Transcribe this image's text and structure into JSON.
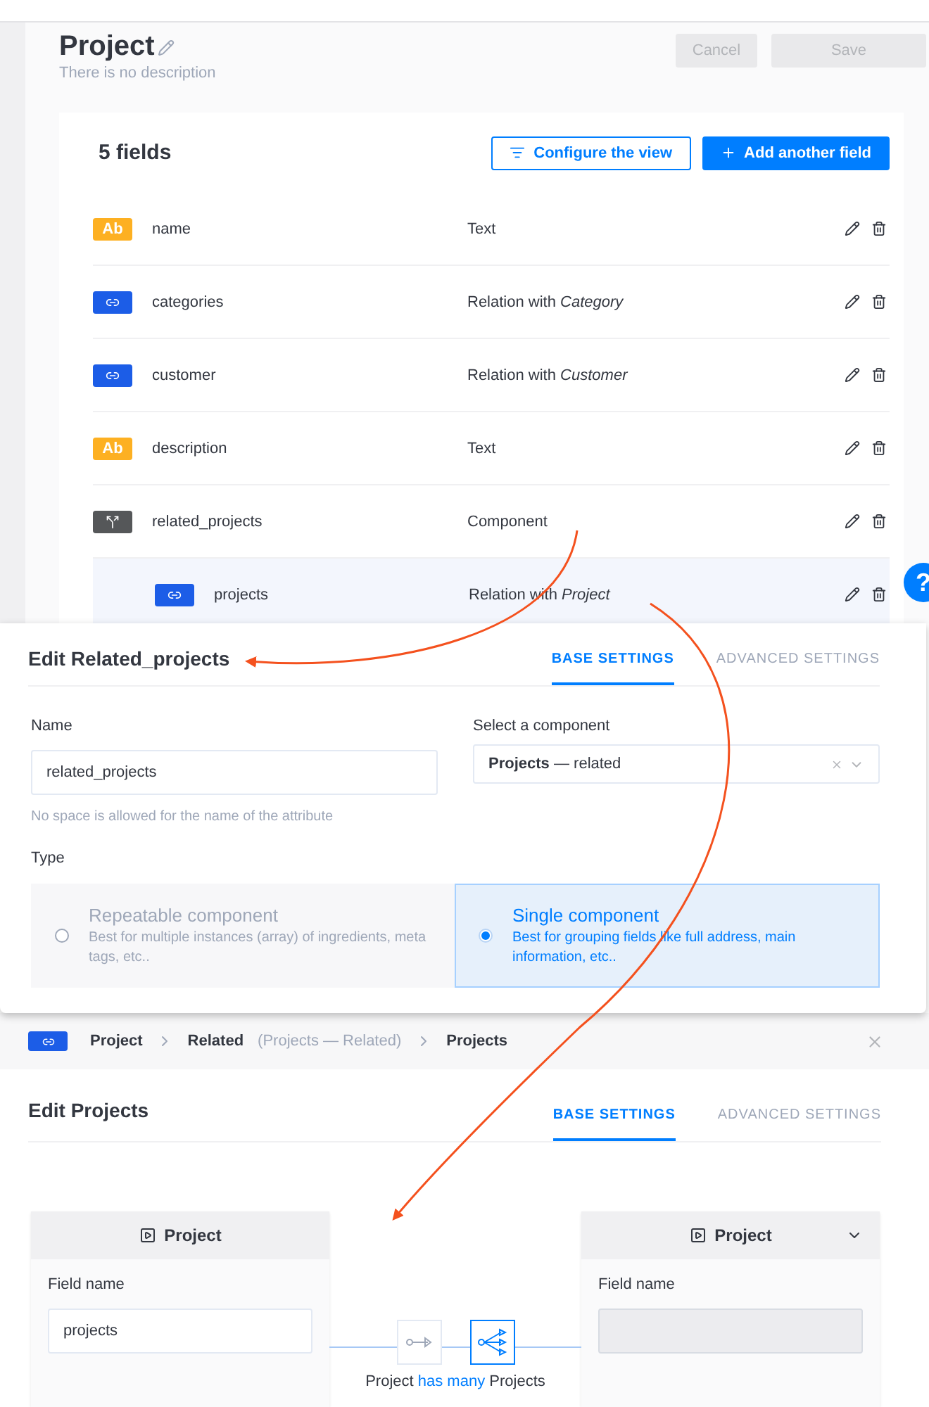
{
  "header": {
    "title": "Project",
    "description": "There is no description",
    "buttons": [
      {
        "label": "Cancel",
        "disabled": true
      },
      {
        "label": "Save",
        "disabled": true
      }
    ]
  },
  "fields_card": {
    "count": "5 fields",
    "actions": [
      {
        "label": "Configure the view",
        "kind": "secondary"
      },
      {
        "label": "Add another field",
        "kind": "primary"
      }
    ],
    "rows": [
      {
        "kind": "text",
        "badge": "Ab",
        "name": "name",
        "type": "Text",
        "highlighted": false
      },
      {
        "kind": "relation",
        "name": "categories",
        "type": "Relation with *Category*",
        "highlighted": false
      },
      {
        "kind": "relation",
        "name": "customer",
        "type": "Relation with *Customer*",
        "highlighted": false
      },
      {
        "kind": "text",
        "badge": "Ab",
        "name": "description",
        "type": "Text",
        "highlighted": false
      },
      {
        "kind": "component",
        "name": "related_projects",
        "type": "Component",
        "highlighted": false,
        "children": [
          {
            "kind": "relation",
            "name": "projects",
            "type": "Relation with *Project*",
            "highlighted": true
          }
        ]
      }
    ]
  },
  "help_button": "?",
  "component_modal": {
    "title": "Edit Related_projects",
    "tabs": [
      {
        "label": "BASE SETTINGS",
        "selected": true
      },
      {
        "label": "ADVANCED SETTINGS",
        "selected": false
      }
    ],
    "name_field": {
      "label": "Name",
      "value": "related_projects",
      "hint": "No space is allowed for the name of the attribute"
    },
    "component_select": {
      "label": "Select a component",
      "value": "**Projects** — related"
    },
    "type": {
      "label": "Type",
      "options": [
        {
          "title": "Repeatable component",
          "description": "Best for multiple instances (array) of ingredients, meta tags, etc..",
          "selected": false
        },
        {
          "title": "Single component",
          "description": "Best for grouping fields like full address, main information, etc..",
          "selected": true
        }
      ]
    }
  },
  "breadcrumb": {
    "items": [
      {
        "label": "Project"
      },
      {
        "label": "Related",
        "note": "(Projects — Related)"
      },
      {
        "label": "Projects"
      }
    ]
  },
  "relation_modal": {
    "title": "Edit Projects",
    "tabs": [
      {
        "label": "BASE SETTINGS",
        "selected": true
      },
      {
        "label": "ADVANCED SETTINGS",
        "selected": false
      }
    ],
    "left": {
      "title": "Project",
      "field_label": "Field name",
      "value": "projects"
    },
    "right": {
      "title": "Project",
      "field_label": "Field name",
      "disabled": true
    },
    "relation_types": [
      {
        "kind": "one-way",
        "selected": false
      },
      {
        "kind": "many-way",
        "selected": true
      }
    ],
    "summary": "Project **has many** Projects"
  }
}
